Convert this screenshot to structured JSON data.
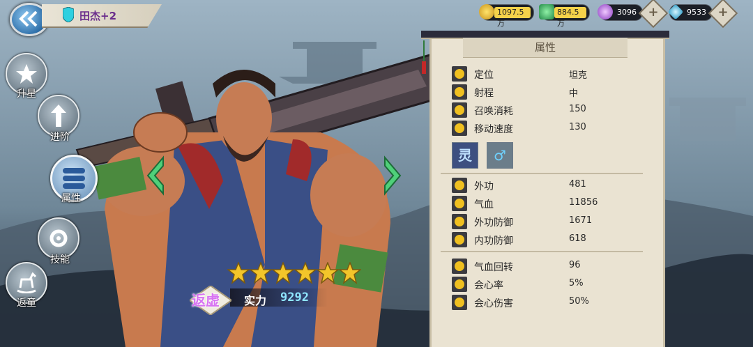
{
  "header": {
    "hero_name": "田杰+2",
    "resources": [
      {
        "name": "gold",
        "value": "1097.5万",
        "color": "#f2c230"
      },
      {
        "name": "jade",
        "value": "884.5万",
        "color": "#45c06b"
      },
      {
        "name": "spirit",
        "value": "3096",
        "color": "#c08ae0"
      },
      {
        "name": "diamond",
        "value": "9533",
        "color": "#6fd2f0"
      }
    ]
  },
  "menu": [
    {
      "label": "升星",
      "icon": "star-icon"
    },
    {
      "label": "进阶",
      "icon": "arrow-up-icon"
    },
    {
      "label": "属性",
      "icon": "list-icon",
      "active": true
    },
    {
      "label": "技能",
      "icon": "gear-icon"
    },
    {
      "label": "返童",
      "icon": "rocking-horse-icon"
    }
  ],
  "hero": {
    "stars": 6,
    "rank": "返虚",
    "power_label": "实力",
    "power_value": "9292"
  },
  "attributes": {
    "title": "属性",
    "basic": [
      {
        "label": "定位",
        "value": "坦克"
      },
      {
        "label": "射程",
        "value": "中"
      },
      {
        "label": "召唤消耗",
        "value": "150"
      },
      {
        "label": "移动速度",
        "value": "130"
      }
    ],
    "tags": [
      "灵",
      "♂"
    ],
    "combat": [
      {
        "label": "外功",
        "value": "481"
      },
      {
        "label": "气血",
        "value": "11856"
      },
      {
        "label": "外功防御",
        "value": "1671"
      },
      {
        "label": "内功防御",
        "value": "618"
      }
    ],
    "extra": [
      {
        "label": "气血回转",
        "value": "96"
      },
      {
        "label": "会心率",
        "value": "5%"
      },
      {
        "label": "会心伤害",
        "value": "50%"
      }
    ]
  }
}
